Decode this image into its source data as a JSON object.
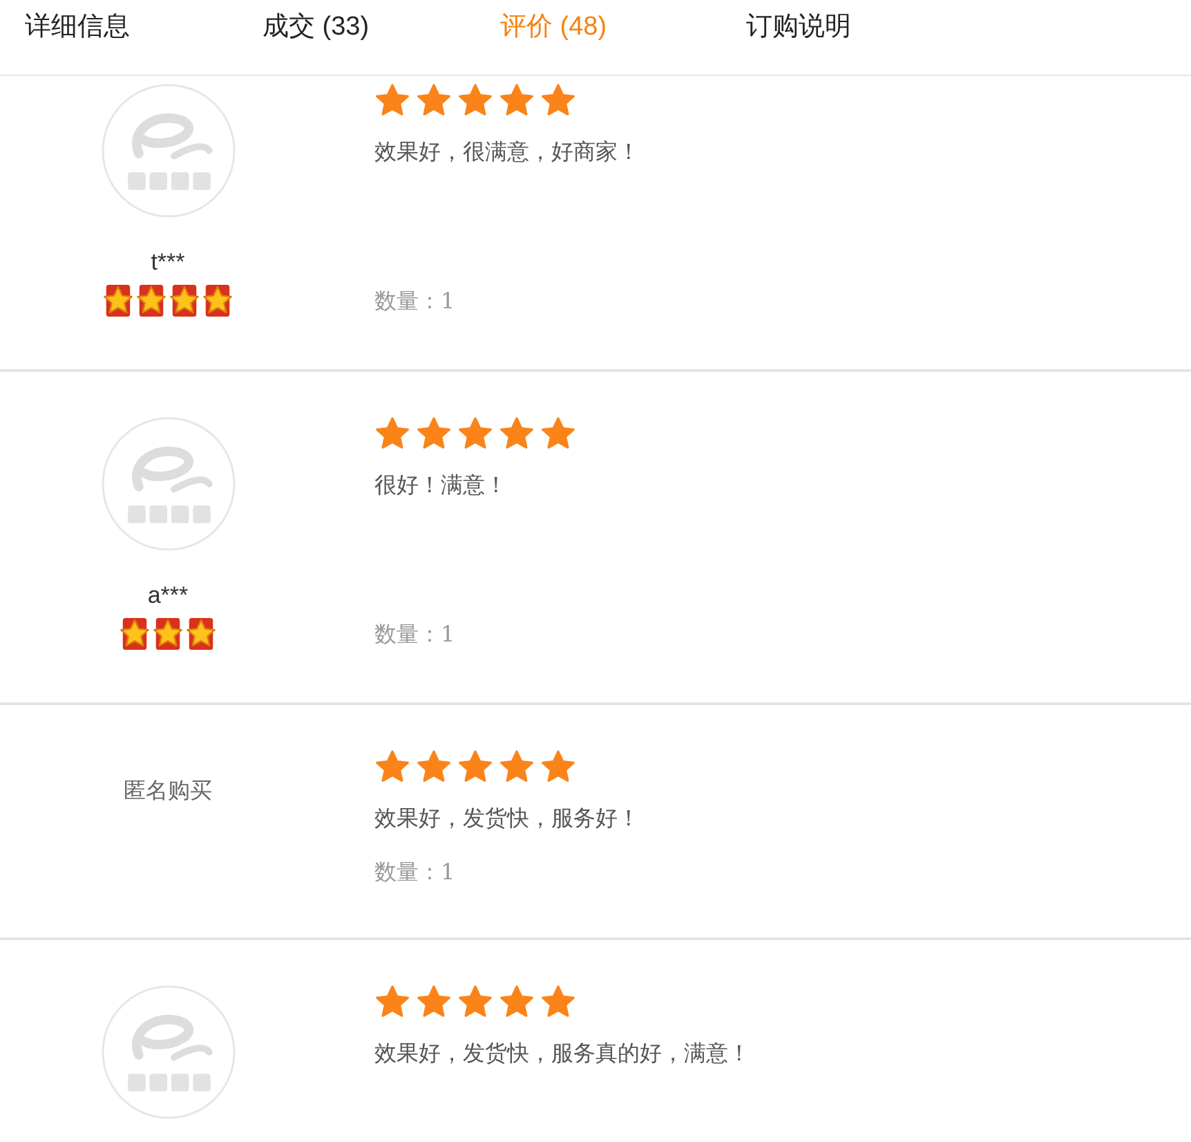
{
  "tabs": [
    {
      "label": "详细信息",
      "selected": false
    },
    {
      "label": "成交 (33)",
      "selected": false
    },
    {
      "label": "评价 (48)",
      "selected": true
    },
    {
      "label": "订购说明",
      "selected": false
    }
  ],
  "reviews": [
    {
      "kind": "member",
      "name": "t***",
      "stars_row": {
        "stars": 4
      },
      "rating": {
        "stars": 5
      },
      "comment": "效果好，很满意，好商家！",
      "quantity": "数量：1"
    },
    {
      "kind": "member",
      "name": "a***",
      "stars_row": {
        "stars": 3
      },
      "rating": {
        "stars": 5
      },
      "comment": "很好！满意！",
      "quantity": "数量：1"
    },
    {
      "kind": "anonymous",
      "name": "匿名购买",
      "rating": {
        "stars": 5
      },
      "comment": "效果好，发货快，服务好！",
      "quantity": "数量：1"
    },
    {
      "kind": "member",
      "rating": {
        "stars": 5
      },
      "comment": "效果好，发货快，服务真的好，满意！"
    }
  ]
}
